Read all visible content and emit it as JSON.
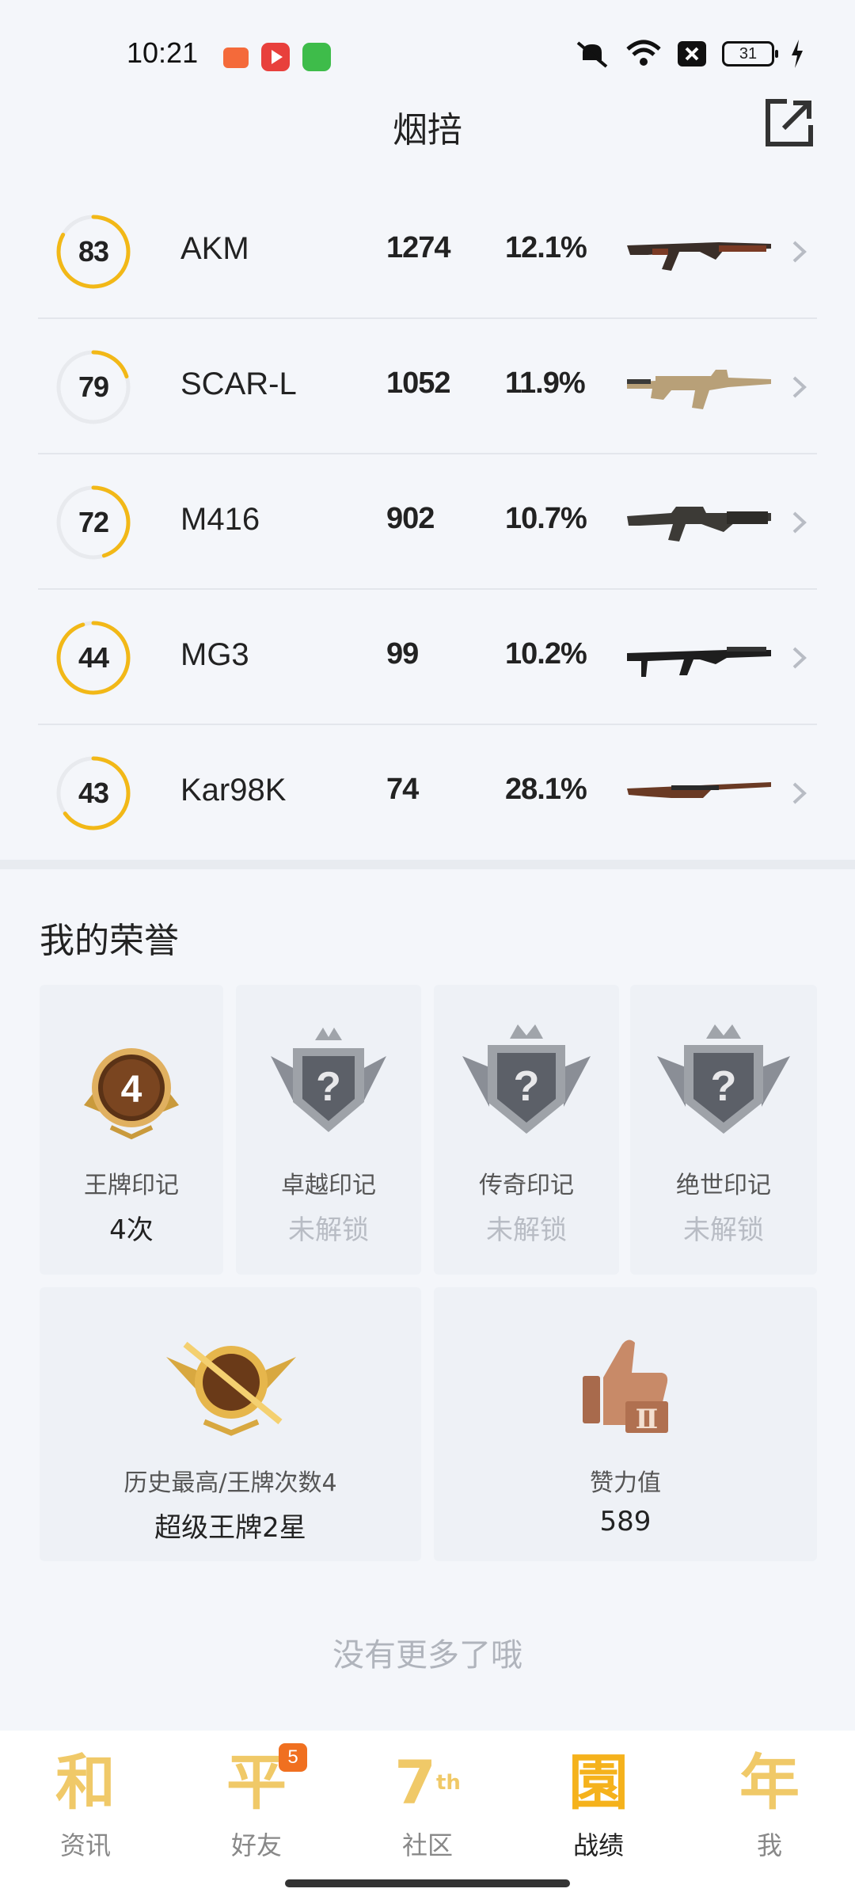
{
  "status": {
    "time": "10:21",
    "battery": "31"
  },
  "header": {
    "title": "烟掊"
  },
  "weapons": [
    {
      "score": "83",
      "progress": 0.83,
      "name": "AKM",
      "kills": "1274",
      "rate": "12.1%"
    },
    {
      "score": "79",
      "progress": 0.2,
      "name": "SCAR-L",
      "kills": "1052",
      "rate": "11.9%"
    },
    {
      "score": "72",
      "progress": 0.45,
      "name": "M416",
      "kills": "902",
      "rate": "10.7%"
    },
    {
      "score": "44",
      "progress": 0.95,
      "name": "MG3",
      "kills": "99",
      "rate": "10.2%"
    },
    {
      "score": "43",
      "progress": 0.65,
      "name": "Kar98K",
      "kills": "74",
      "rate": "28.1%"
    }
  ],
  "honors": {
    "title": "我的荣誉",
    "marks": [
      {
        "label": "王牌印记",
        "value": "4次",
        "badge_num": "4",
        "locked": false
      },
      {
        "label": "卓越印记",
        "value": "未解锁",
        "locked": true
      },
      {
        "label": "传奇印记",
        "value": "未解锁",
        "locked": true
      },
      {
        "label": "绝世印记",
        "value": "未解锁",
        "locked": true
      }
    ],
    "rank": {
      "label": "历史最高/王牌次数4",
      "value": "超级王牌2星"
    },
    "likes": {
      "label": "赞力值",
      "value": "589"
    }
  },
  "footer_text": "没有更多了哦",
  "nav": [
    {
      "glyph": "和",
      "label": "资讯"
    },
    {
      "glyph": "平",
      "label": "好友",
      "badge": "5"
    },
    {
      "glyph": "7",
      "sup": "th",
      "label": "社区"
    },
    {
      "glyph": "園",
      "label": "战绩",
      "active": true
    },
    {
      "glyph": "年",
      "label": "我"
    }
  ],
  "colors": {
    "accent": "#f2b817",
    "ring_track": "#e8eaee",
    "nav_gold": "#f0c968",
    "badge_orange": "#f07020"
  }
}
